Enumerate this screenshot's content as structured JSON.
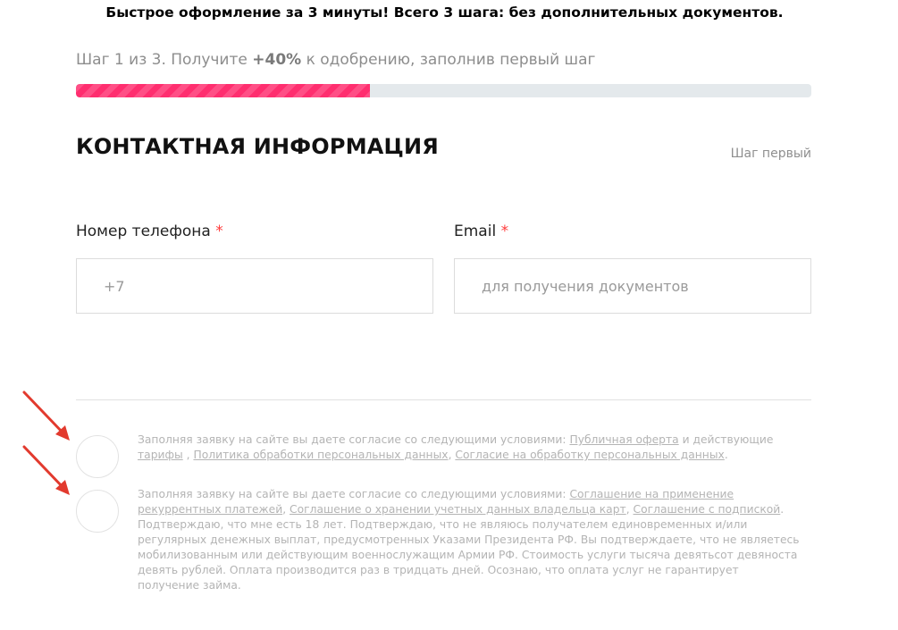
{
  "banner": "Быстрое оформление за 3 минуты! Всего 3 шага: без дополнительных документов.",
  "progress": {
    "text_before": "Шаг 1 из 3. Получите ",
    "highlight": "+40%",
    "text_after": " к одобрению, заполнив первый шаг",
    "fill_fraction": 0.4,
    "colors": {
      "fill": "#ff3b78",
      "track": "#e4e9ec"
    }
  },
  "section": {
    "title": "КОНТАКТНАЯ ИНФОРМАЦИЯ",
    "step_label": "Шаг первый"
  },
  "fields": {
    "phone": {
      "label": "Номер телефона",
      "required": "*",
      "placeholder": "+7"
    },
    "email": {
      "label": "Email",
      "required": "*",
      "placeholder": "для получения документов"
    }
  },
  "consent1": {
    "intro": "Заполняя заявку на сайте вы даете согласие со следующими условиями: ",
    "link_offer": "Публичная оферта",
    "and_text": " и действующие ",
    "link_tariffs": "тарифы",
    "sep1": " , ",
    "link_privacy": "Политика обработки персональных данных",
    "sep2": ", ",
    "link_personal": "Согласие на обработку персональных данных",
    "end": "."
  },
  "consent2": {
    "intro": "Заполняя заявку на сайте вы даете согласие со следующими условиями: ",
    "link_recurrent": "Соглашение на применение рекуррентных платежей",
    "sep1": ", ",
    "link_storage": "Соглашение о хранении учетных данных владельца карт",
    "sep2": ", ",
    "link_subscription": "Соглашение с подпиской",
    "body": ". Подтверждаю, что мне есть 18 лет. Подтверждаю, что не являюсь получателем единовременных и/или регулярных денежных выплат, предусмотренных Указами Президента РФ. Вы подтверждаете, что не являетесь мобилизованным или действующим военнослужащим Армии РФ. Стоимость услуги тысяча девятьсот девяноста девять рублей. Оплата производится раз в тридцать дней. Осознаю, что оплата услуг не гарантирует получение займа."
  },
  "arrow_color": "#e23a2e"
}
